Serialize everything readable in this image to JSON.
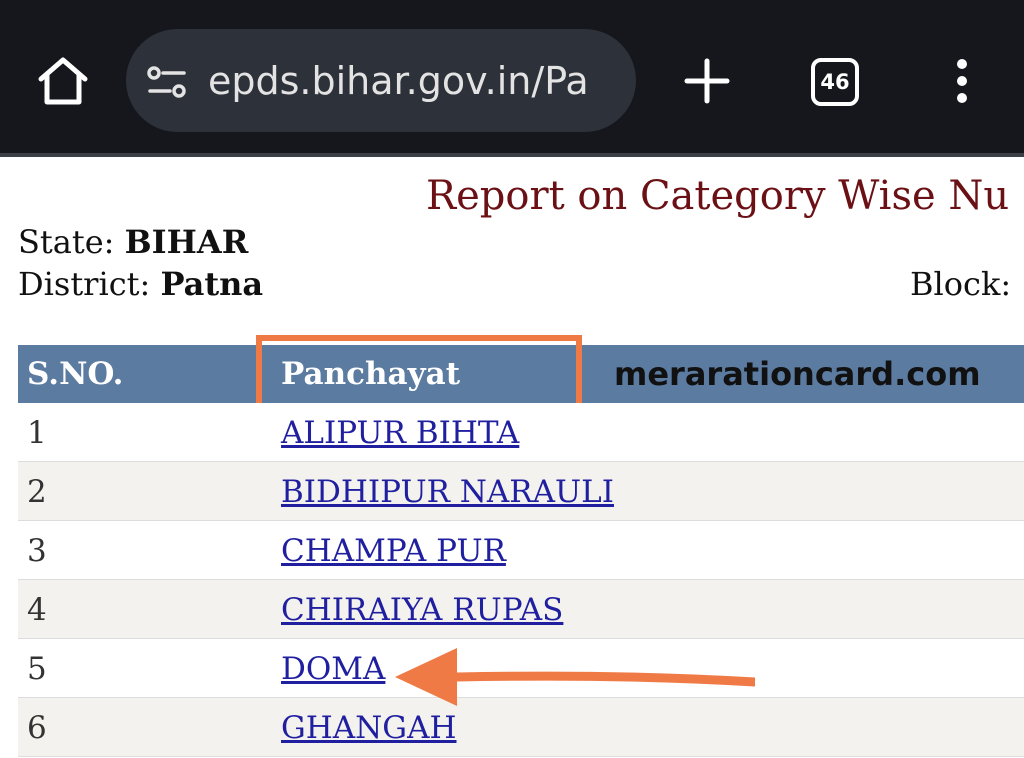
{
  "browser": {
    "url": "epds.bihar.gov.in/Pa",
    "tab_count": "46",
    "icons": {
      "home": "home-icon",
      "site_info": "tune-icon",
      "new_tab": "plus-icon",
      "tabs": "tab-switcher-icon",
      "menu": "more-vert-icon"
    }
  },
  "page": {
    "title": "Report on Category Wise Nu",
    "state_label": "State:",
    "state_value": "BIHAR",
    "district_label": "District:",
    "district_value": "Patna",
    "block_label": "Block:",
    "block_value": "",
    "watermark": "meraration card.com"
  },
  "table": {
    "headers": {
      "sno": "S.NO.",
      "panchayat": "Panchayat"
    },
    "rows": [
      {
        "sno": "1",
        "panchayat": "ALIPUR BIHTA"
      },
      {
        "sno": "2",
        "panchayat": "BIDHIPUR NARAULI"
      },
      {
        "sno": "3",
        "panchayat": "CHAMPA PUR"
      },
      {
        "sno": "4",
        "panchayat": "CHIRAIYA RUPAS"
      },
      {
        "sno": "5",
        "panchayat": "DOMA"
      },
      {
        "sno": "6",
        "panchayat": "GHANGAH"
      }
    ]
  },
  "colors": {
    "chrome_bg": "#15171c",
    "omnibox_bg": "#2d3139",
    "title": "#6b1116",
    "header_bg": "#5b7ba0",
    "link": "#1f1fa0",
    "highlight": "#f07a45",
    "row_alt": "#f4f2ee"
  }
}
